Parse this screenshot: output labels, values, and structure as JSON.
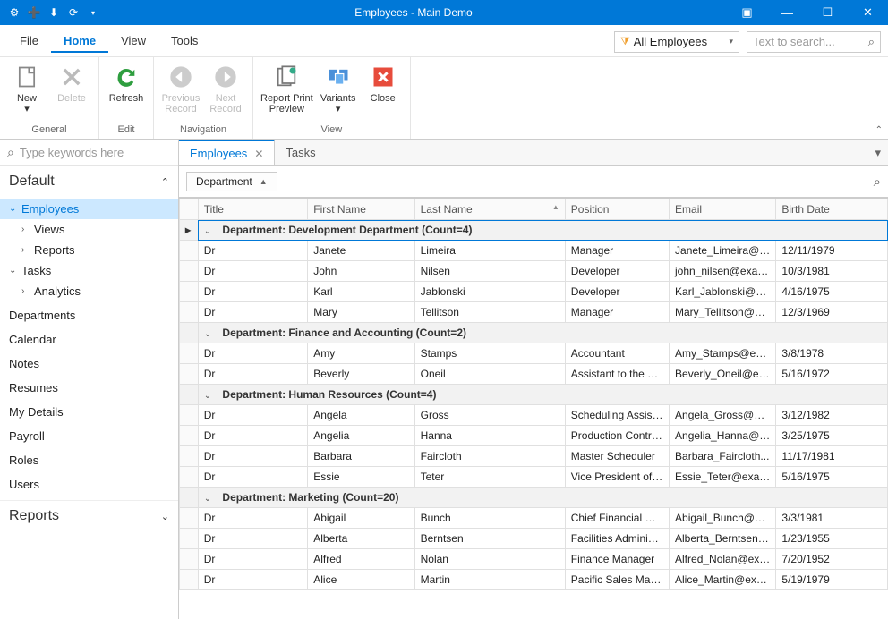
{
  "window": {
    "title": "Employees - Main Demo"
  },
  "menubar": {
    "tabs": [
      "File",
      "Home",
      "View",
      "Tools"
    ],
    "active": 1,
    "filter_label": "All Employees",
    "search_placeholder": "Text to search..."
  },
  "ribbon": {
    "groups": [
      {
        "label": "General",
        "buttons": [
          {
            "label": "New",
            "sub": "▾",
            "icon": "new"
          },
          {
            "label": "Delete",
            "icon": "delete",
            "disabled": true
          }
        ]
      },
      {
        "label": "Edit",
        "buttons": [
          {
            "label": "Refresh",
            "icon": "refresh"
          }
        ]
      },
      {
        "label": "Navigation",
        "buttons": [
          {
            "label": "Previous",
            "sub": "Record",
            "icon": "prev",
            "disabled": true
          },
          {
            "label": "Next",
            "sub": "Record",
            "icon": "next",
            "disabled": true
          }
        ]
      },
      {
        "label": "View",
        "buttons": [
          {
            "label": "Report Print",
            "sub": "Preview",
            "icon": "print"
          },
          {
            "label": "Variants",
            "sub": "▾",
            "icon": "variants"
          },
          {
            "label": "Close",
            "icon": "close"
          }
        ]
      }
    ]
  },
  "sidebar": {
    "placeholder": "Type keywords here",
    "section1": "Default",
    "section2": "Reports",
    "tree": [
      {
        "label": "Employees",
        "level": 0,
        "chev": "v",
        "selected": true
      },
      {
        "label": "Views",
        "level": 1,
        "chev": ">"
      },
      {
        "label": "Reports",
        "level": 1,
        "chev": ">"
      },
      {
        "label": "Tasks",
        "level": 0,
        "chev": "v"
      },
      {
        "label": "Analytics",
        "level": 1,
        "chev": ">"
      }
    ],
    "plain": [
      "Departments",
      "Calendar",
      "Notes",
      "Resumes",
      "My Details",
      "Payroll",
      "Roles",
      "Users"
    ]
  },
  "doctabs": {
    "tabs": [
      "Employees",
      "Tasks"
    ],
    "active": 0
  },
  "grouping": {
    "field": "Department"
  },
  "grid": {
    "columns": [
      "Title",
      "First Name",
      "Last Name",
      "Position",
      "Email",
      "Birth Date"
    ],
    "sorted_col": 2,
    "data": [
      {
        "group": "Department: Development Department (Count=4)",
        "first": true
      },
      {
        "row": [
          "Dr",
          "Janete",
          "Limeira",
          "Manager",
          "Janete_Limeira@ex...",
          "12/11/1979"
        ]
      },
      {
        "row": [
          "Dr",
          "John",
          "Nilsen",
          "Developer",
          "john_nilsen@exampl...",
          "10/3/1981"
        ]
      },
      {
        "row": [
          "Dr",
          "Karl",
          "Jablonski",
          "Developer",
          "Karl_Jablonski@exa...",
          "4/16/1975"
        ]
      },
      {
        "row": [
          "Dr",
          "Mary",
          "Tellitson",
          "Manager",
          "Mary_Tellitson@ex...",
          "12/3/1969"
        ]
      },
      {
        "group": "Department: Finance and Accounting (Count=2)"
      },
      {
        "row": [
          "Dr",
          "Amy",
          "Stamps",
          "Accountant",
          "Amy_Stamps@exam...",
          "3/8/1978"
        ]
      },
      {
        "row": [
          "Dr",
          "Beverly",
          "Oneil",
          "Assistant to the Chi...",
          "Beverly_Oneil@exa...",
          "5/16/1972"
        ]
      },
      {
        "group": "Department: Human Resources (Count=4)"
      },
      {
        "row": [
          "Dr",
          "Angela",
          "Gross",
          "Scheduling Assistant",
          "Angela_Gross@exa...",
          "3/12/1982"
        ]
      },
      {
        "row": [
          "Dr",
          "Angelia",
          "Hanna",
          "Production Control ...",
          "Angelia_Hanna@ex...",
          "3/25/1975"
        ]
      },
      {
        "row": [
          "Dr",
          "Barbara",
          "Faircloth",
          "Master Scheduler",
          "Barbara_Faircloth...",
          "11/17/1981"
        ]
      },
      {
        "row": [
          "Dr",
          "Essie",
          "Teter",
          "Vice President of Pro...",
          "Essie_Teter@examp...",
          "5/16/1975"
        ]
      },
      {
        "group": "Department: Marketing (Count=20)"
      },
      {
        "row": [
          "Dr",
          "Abigail",
          "Bunch",
          "Chief Financial Officer",
          "Abigail_Bunch@exa...",
          "3/3/1981"
        ]
      },
      {
        "row": [
          "Dr",
          "Alberta",
          "Berntsen",
          "Facilities Administrati...",
          "Alberta_Berntsen@...",
          "1/23/1955"
        ]
      },
      {
        "row": [
          "Dr",
          "Alfred",
          "Nolan",
          "Finance Manager",
          "Alfred_Nolan@exa...",
          "7/20/1952"
        ]
      },
      {
        "row": [
          "Dr",
          "Alice",
          "Martin",
          "Pacific Sales Manager",
          "Alice_Martin@exa...",
          "5/19/1979"
        ]
      }
    ]
  }
}
